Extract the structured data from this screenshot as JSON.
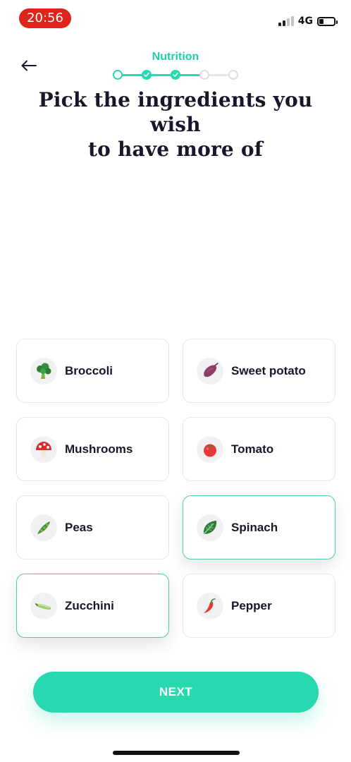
{
  "status_bar": {
    "time": "20:56",
    "network": "4G",
    "signal_bars_active": 2,
    "signal_bars_total": 4,
    "battery_level": 0.3
  },
  "header": {
    "back_icon": "arrow-left-icon",
    "step_title": "Nutrition",
    "steps": [
      {
        "state": "current"
      },
      {
        "state": "completed"
      },
      {
        "state": "completed"
      },
      {
        "state": "upcoming"
      },
      {
        "state": "upcoming"
      }
    ]
  },
  "title": {
    "line1": "Pick the ingredients you wish",
    "line2": "to have more of"
  },
  "ingredients": [
    {
      "label": "Broccoli",
      "icon": "broccoli-icon",
      "selected": false
    },
    {
      "label": "Sweet potato",
      "icon": "sweet-potato-icon",
      "selected": false
    },
    {
      "label": "Mushrooms",
      "icon": "mushroom-icon",
      "selected": false
    },
    {
      "label": "Tomato",
      "icon": "tomato-icon",
      "selected": false
    },
    {
      "label": "Peas",
      "icon": "peas-icon",
      "selected": false
    },
    {
      "label": "Spinach",
      "icon": "spinach-icon",
      "selected": true
    },
    {
      "label": "Zucchini",
      "icon": "zucchini-icon",
      "selected": true
    },
    {
      "label": "Pepper",
      "icon": "pepper-icon",
      "selected": false
    }
  ],
  "next_button": {
    "label": "NEXT"
  },
  "colors": {
    "accent": "#28d9b0",
    "accent_text": "#1fcfa7",
    "selected_border": "#47d0ad",
    "title": "#15172b",
    "time_badge": "#e0241b"
  }
}
